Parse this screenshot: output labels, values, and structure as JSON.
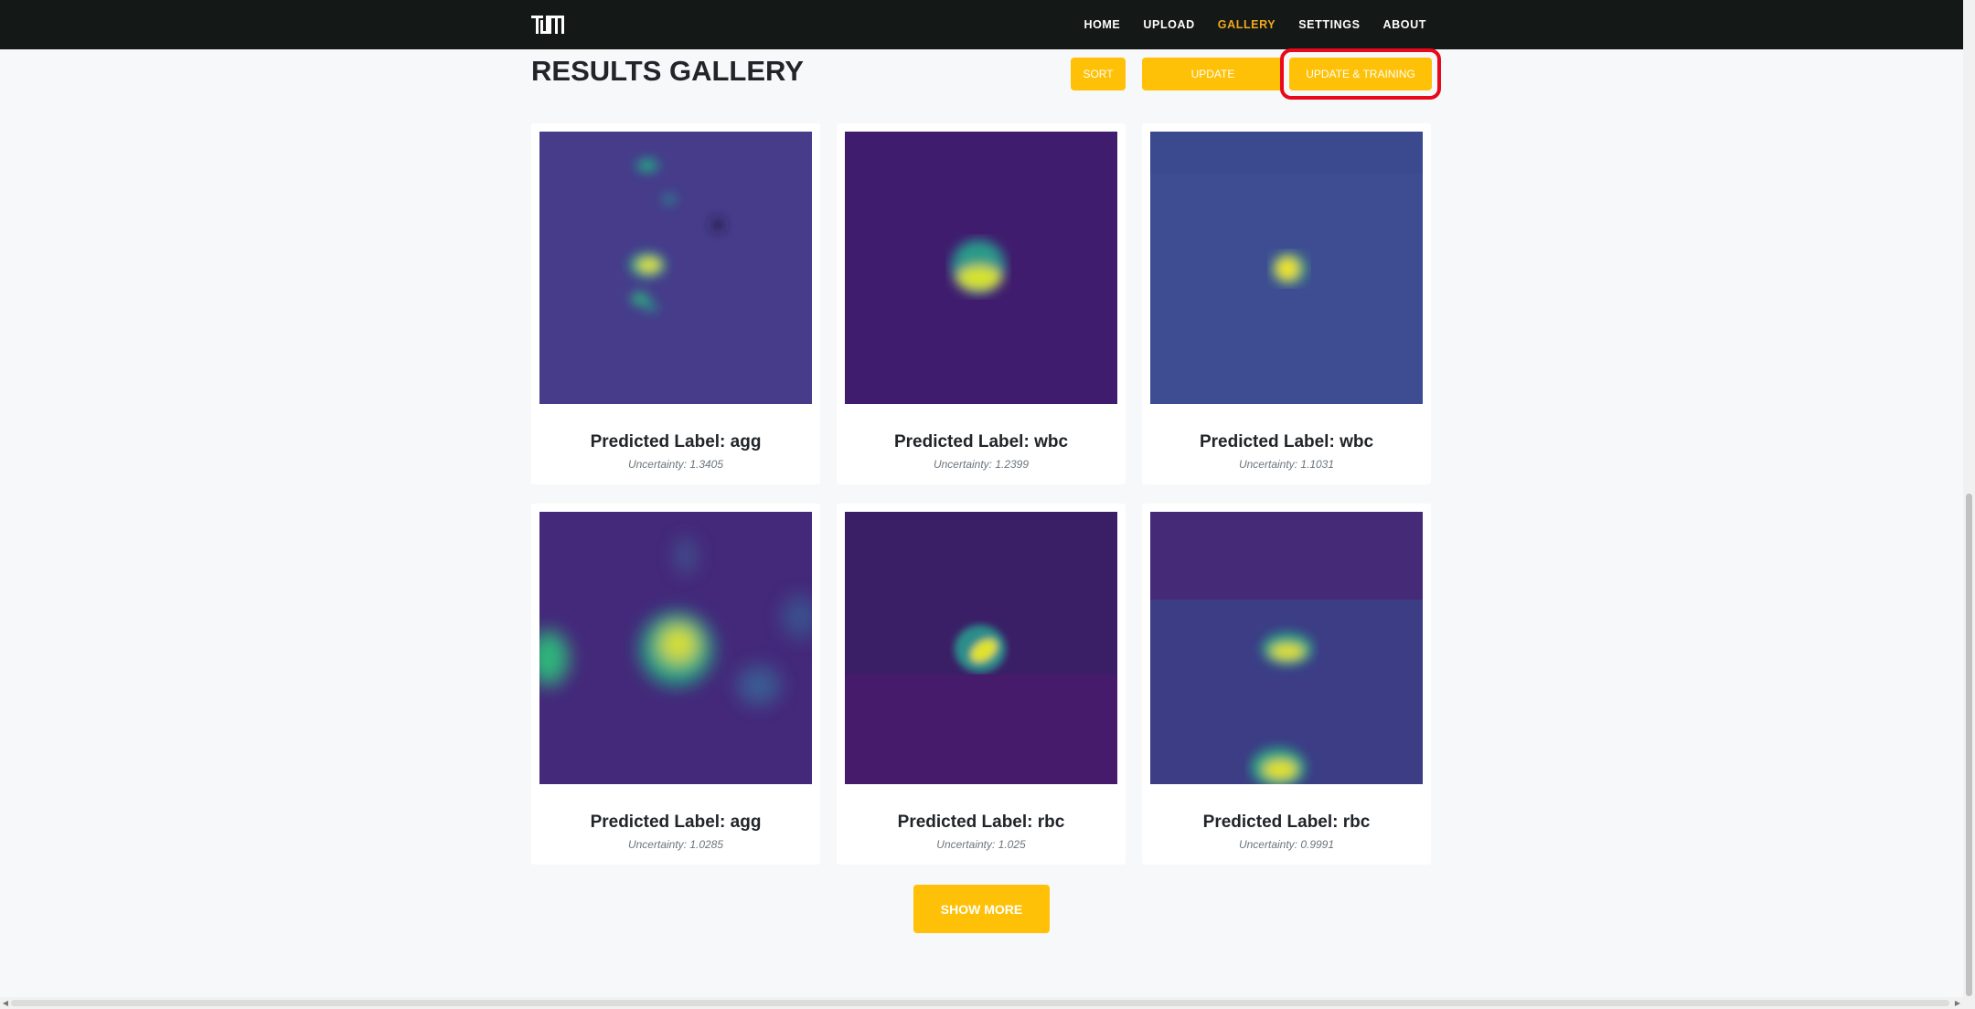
{
  "nav": {
    "logo_alt": "TUM",
    "items": [
      {
        "label": "HOME",
        "active": false
      },
      {
        "label": "UPLOAD",
        "active": false
      },
      {
        "label": "GALLERY",
        "active": true
      },
      {
        "label": "SETTINGS",
        "active": false
      },
      {
        "label": "ABOUT",
        "active": false
      }
    ]
  },
  "header": {
    "title": "RESULTS GALLERY",
    "sort_label": "SORT",
    "update_label": "UPDATE",
    "update_training_label": "UPDATE & TRAINING"
  },
  "gallery": {
    "cards": [
      {
        "label": "Predicted Label: agg",
        "uncertainty": "Uncertainty: 1.3405"
      },
      {
        "label": "Predicted Label: wbc",
        "uncertainty": "Uncertainty: 1.2399"
      },
      {
        "label": "Predicted Label: wbc",
        "uncertainty": "Uncertainty: 1.1031"
      },
      {
        "label": "Predicted Label: agg",
        "uncertainty": "Uncertainty: 1.0285"
      },
      {
        "label": "Predicted Label: rbc",
        "uncertainty": "Uncertainty: 1.025"
      },
      {
        "label": "Predicted Label: rbc",
        "uncertainty": "Uncertainty: 0.9991"
      }
    ],
    "show_more_label": "SHOW MORE"
  },
  "colors": {
    "accent": "#ffc107",
    "nav_active": "#f0a81e",
    "navbar_bg": "#141816",
    "highlight": "#e8091b"
  }
}
